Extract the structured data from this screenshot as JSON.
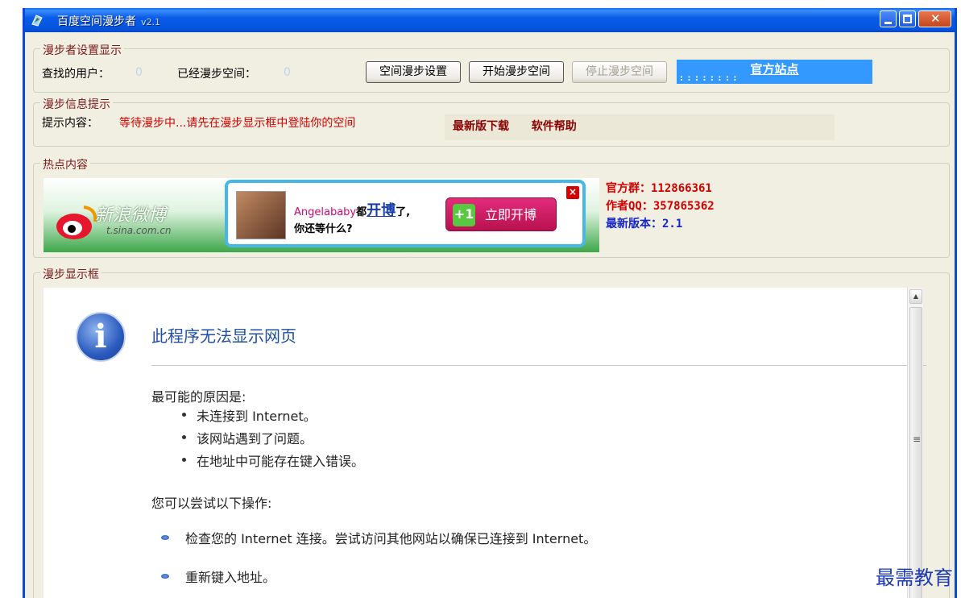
{
  "window": {
    "title": "百度空间漫步者",
    "version": "v2.1"
  },
  "settings": {
    "legend": "漫步者设置显示",
    "found_users_label": "查找的用户：",
    "found_users_value": "0",
    "walked_spaces_label": "已经漫步空间：",
    "walked_spaces_value": "0",
    "settings_button": "空间漫步设置",
    "start_button": "开始漫步空间",
    "stop_button": "停止漫步空间",
    "official_site": "官方站点",
    "official_site_dots": ": : : : : : : :"
  },
  "info": {
    "legend": "漫步信息提示",
    "tip_label": "提示内容：",
    "tip_text": "等待漫步中...请先在漫步显示框中登陆你的空间",
    "download_link": "最新版下载",
    "help_link": "软件帮助"
  },
  "hot": {
    "legend": "热点内容",
    "ad": {
      "logo_text": "新浪微博",
      "url": "t.sina.com.cn",
      "name": "Angelababy",
      "text_du": "都",
      "text_kaibo": "开博",
      "text_le": "了,",
      "line2": "你还等什么?",
      "open_button": "立即开博",
      "plus": "+1",
      "close": "×"
    },
    "qq_group": "官方群：112866361",
    "author_qq": "作者QQ：357865362",
    "latest_version": "最新版本：2.1",
    "colors": {
      "red": "#d40000",
      "blue": "#1525c8"
    }
  },
  "display": {
    "legend": "漫步显示框",
    "error_title": "此程序无法显示网页",
    "reasons_heading": "最可能的原因是:",
    "reasons": [
      "未连接到 Internet。",
      "该网站遇到了问题。",
      "在地址中可能存在键入错误。"
    ],
    "try_heading": "您可以尝试以下操作:",
    "actions": [
      "检查您的 Internet 连接。尝试访问其他网站以确保已连接到 Internet。",
      "重新键入地址。"
    ],
    "scroll_grip": "≡"
  },
  "watermark": "最需教育"
}
